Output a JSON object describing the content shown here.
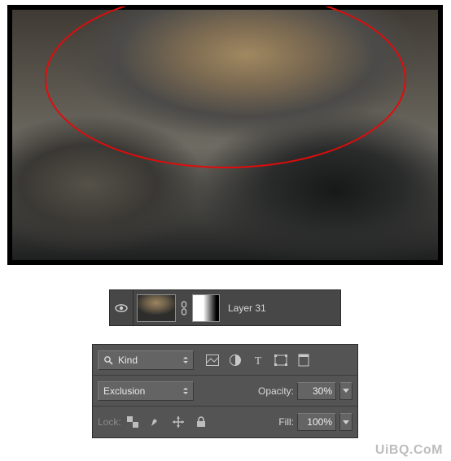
{
  "layer_row": {
    "visibility": "visible",
    "label": "Layer 31"
  },
  "opts": {
    "filter_kind_label": "Kind",
    "blend_mode": "Exclusion",
    "opacity_label": "Opacity:",
    "opacity_value": "30%",
    "fill_label": "Fill:",
    "fill_value": "100%",
    "lock_label": "Lock:"
  },
  "icons": {
    "search": "search-icon",
    "image": "image-filter-icon",
    "adjustment": "adjustment-filter-icon",
    "type": "type-filter-icon",
    "shape": "shape-filter-icon",
    "smart": "smart-filter-icon"
  },
  "watermark": "UiBQ.CoM"
}
